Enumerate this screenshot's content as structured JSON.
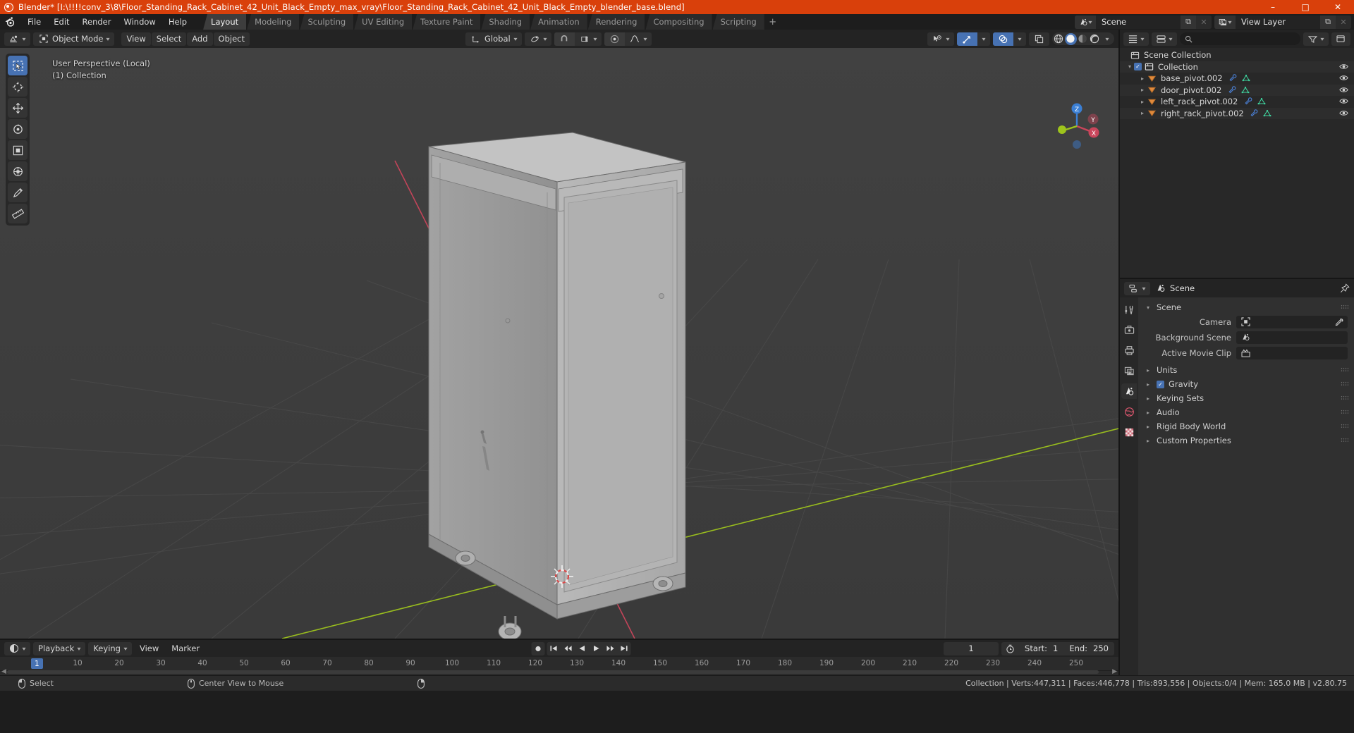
{
  "titlebar": {
    "text": "Blender* [I:\\!!!!conv_3\\8\\Floor_Standing_Rack_Cabinet_42_Unit_Black_Empty_max_vray\\Floor_Standing_Rack_Cabinet_42_Unit_Black_Empty_blender_base.blend]",
    "minimize": "–",
    "maximize": "□",
    "close": "✕",
    "accent": "#d9400b"
  },
  "topbar": {
    "menus": [
      "File",
      "Edit",
      "Render",
      "Window",
      "Help"
    ],
    "workspaces": [
      {
        "label": "Layout",
        "active": true
      },
      {
        "label": "Modeling",
        "active": false
      },
      {
        "label": "Sculpting",
        "active": false
      },
      {
        "label": "UV Editing",
        "active": false
      },
      {
        "label": "Texture Paint",
        "active": false
      },
      {
        "label": "Shading",
        "active": false
      },
      {
        "label": "Animation",
        "active": false
      },
      {
        "label": "Rendering",
        "active": false
      },
      {
        "label": "Compositing",
        "active": false
      },
      {
        "label": "Scripting",
        "active": false
      }
    ],
    "add_workspace": "+",
    "scene_name": "Scene",
    "view_layer_name": "View Layer",
    "new_copy": "⧉",
    "unlink": "✕"
  },
  "viewport_header": {
    "editor_type": "editor-type-3dview",
    "mode": "Object Mode",
    "menus": [
      "View",
      "Select",
      "Add",
      "Object"
    ],
    "transform_orientation": "Global",
    "pivot_icon": "pivot-point-icon",
    "snap_icon": "magnet-icon",
    "snap_to": "snap-increment-icon",
    "proportional_icon": "proportional-editing-icon",
    "falloff_icon": "smooth-falloff-icon",
    "visibility_icon": "object-types-visibility-icon",
    "gizmo_icon": "gizmo-icon",
    "overlays_icon": "overlays-icon",
    "xray_icon": "xray-toggle-icon",
    "shading_modes": [
      "wireframe",
      "solid",
      "material-preview",
      "rendered"
    ],
    "shading_active": "solid"
  },
  "viewport": {
    "overlay_line1": "User Perspective (Local)",
    "overlay_line2": "(1) Collection",
    "tools": [
      "select-box-tool",
      "cursor-tool",
      "move-tool",
      "rotate-tool",
      "scale-tool",
      "transform-tool",
      "annotate-tool",
      "measure-tool"
    ],
    "active_tool": "select-box-tool",
    "gizmo_axes": {
      "x": "X",
      "y": "Y",
      "z": "Z"
    },
    "nav_icons": [
      "zoom-icon",
      "move-view-icon",
      "camera-view-icon",
      "toggle-ortho-icon"
    ],
    "colors": {
      "bg_top": "#3f3f3f",
      "bg_bottom": "#3b3b3b",
      "grid": "#4c4c4c",
      "axis_x": "#c9455b",
      "axis_y": "#9ec41c",
      "axis_z": "#3b7fd4",
      "object_fill": "#b5b5b5",
      "object_shade": "#8e8e8e"
    }
  },
  "timeline": {
    "editor_icon": "timeline-editor-icon",
    "menus": [
      "Playback",
      "Keying",
      "View",
      "Marker"
    ],
    "record_icon": "auto-keying-icon",
    "transport": [
      "jump-start-icon",
      "prev-keyframe-icon",
      "play-reverse-icon",
      "play-icon",
      "next-keyframe-icon",
      "jump-end-icon"
    ],
    "current_frame": "1",
    "timer_icon": "use-preview-range-icon",
    "start_label": "Start:",
    "start_value": "1",
    "end_label": "End:",
    "end_value": "250",
    "ticks": [
      "10",
      "20",
      "30",
      "40",
      "50",
      "60",
      "70",
      "80",
      "90",
      "100",
      "110",
      "120",
      "130",
      "140",
      "150",
      "160",
      "170",
      "180",
      "190",
      "200",
      "210",
      "220",
      "230",
      "240",
      "250"
    ],
    "playhead_frame": "1"
  },
  "outliner": {
    "editor_icon": "outliner-editor-icon",
    "display_mode_icon": "display-mode-icon",
    "search_placeholder": "",
    "filter_icon": "filter-icon",
    "new_collection_icon": "new-collection-icon",
    "root": "Scene Collection",
    "rows": [
      {
        "label": "Collection",
        "indent": 14,
        "type": "collection",
        "expanded": true,
        "checkbox": true,
        "eye": true,
        "icons": []
      },
      {
        "label": "base_pivot.002",
        "indent": 40,
        "type": "object-empty",
        "expanded": false,
        "checkbox": false,
        "eye": true,
        "icons": [
          "modifier-icon",
          "mesh-data-icon"
        ]
      },
      {
        "label": "door_pivot.002",
        "indent": 40,
        "type": "object-empty",
        "expanded": false,
        "checkbox": false,
        "eye": true,
        "icons": [
          "modifier-icon",
          "mesh-data-icon"
        ]
      },
      {
        "label": "left_rack_pivot.002",
        "indent": 40,
        "type": "object-empty",
        "expanded": false,
        "checkbox": false,
        "eye": true,
        "icons": [
          "modifier-icon",
          "mesh-data-icon"
        ]
      },
      {
        "label": "right_rack_pivot.002",
        "indent": 40,
        "type": "object-empty",
        "expanded": false,
        "checkbox": false,
        "eye": true,
        "icons": [
          "modifier-icon",
          "mesh-data-icon"
        ]
      }
    ]
  },
  "properties": {
    "editor_icon": "properties-editor-icon",
    "breadcrumb_icon": "scene-icon",
    "breadcrumb": "Scene",
    "pin_icon": "pin-icon",
    "tabs": [
      {
        "name": "tool-tab",
        "active": false
      },
      {
        "name": "render-tab",
        "active": false
      },
      {
        "name": "output-tab",
        "active": false
      },
      {
        "name": "view-layer-tab",
        "active": false
      },
      {
        "name": "scene-tab",
        "active": true
      },
      {
        "name": "world-tab",
        "active": false
      },
      {
        "name": "texture-tab",
        "active": false
      }
    ],
    "panel_title": "Scene",
    "fields": [
      {
        "label": "Camera",
        "icon": "camera-object-icon",
        "eyedropper": true
      },
      {
        "label": "Background Scene",
        "icon": "scene-icon",
        "eyedropper": false
      },
      {
        "label": "Active Movie Clip",
        "icon": "movie-clip-icon",
        "eyedropper": false
      }
    ],
    "panels": [
      {
        "label": "Units",
        "checkbox": false
      },
      {
        "label": "Gravity",
        "checkbox": true
      },
      {
        "label": "Keying Sets",
        "checkbox": false
      },
      {
        "label": "Audio",
        "checkbox": false
      },
      {
        "label": "Rigid Body World",
        "checkbox": false
      },
      {
        "label": "Custom Properties",
        "checkbox": false
      }
    ]
  },
  "statusbar": {
    "mouse_left_label": "Select",
    "mouse_middle_label": "Center View to Mouse",
    "stats": "Collection | Verts:447,311 | Faces:446,778 | Tris:893,556 | Objects:0/4 | Mem: 165.0 MB | v2.80.75"
  }
}
